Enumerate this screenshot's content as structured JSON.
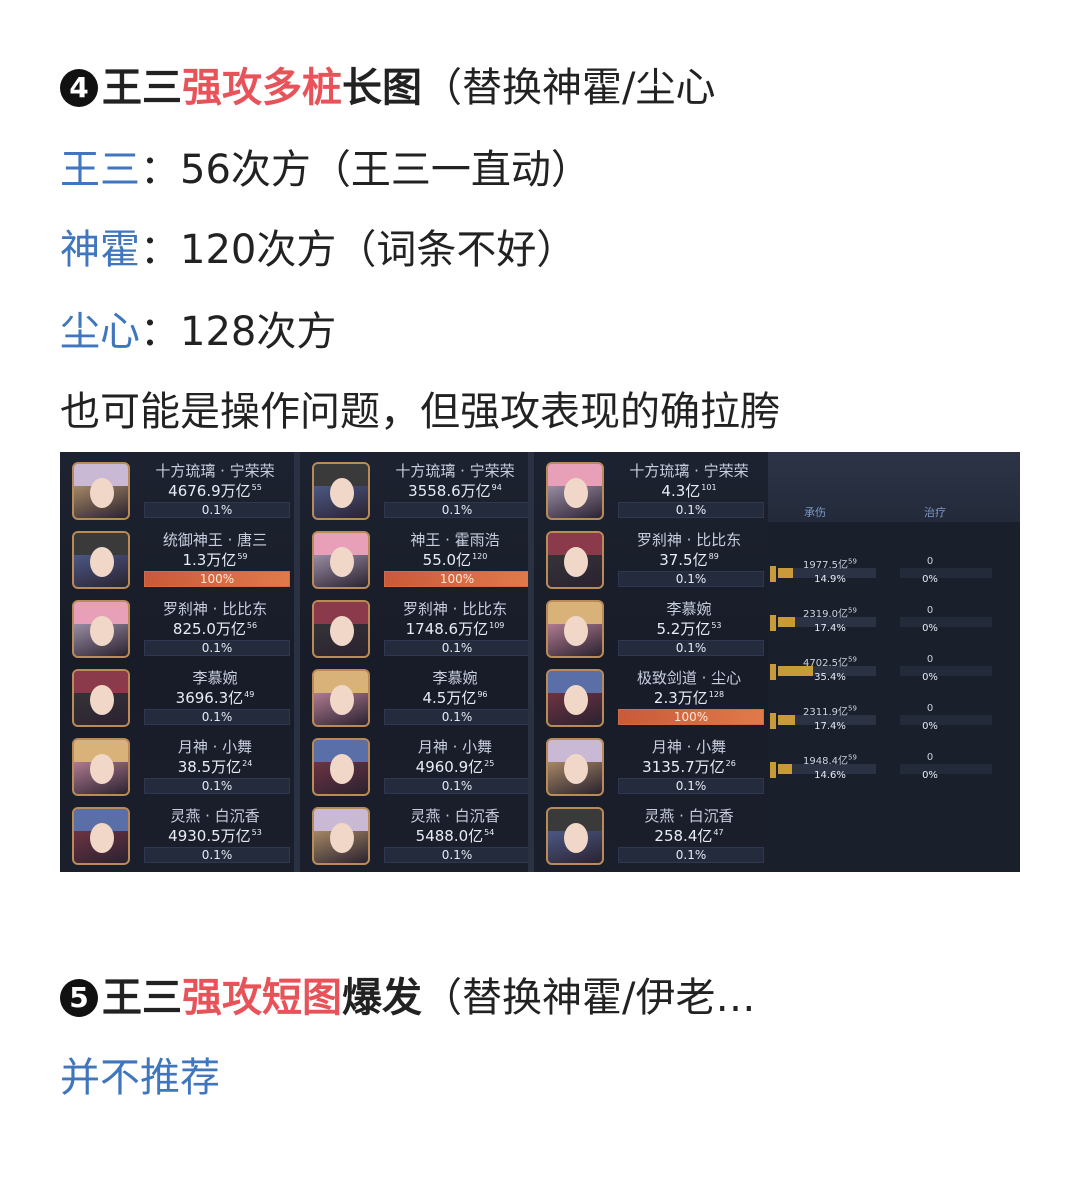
{
  "heading4": {
    "num": "4",
    "part1": "王三",
    "part2_red": "强攻多桩",
    "part3": "长图",
    "part4": "（替换神霍/尘心"
  },
  "lines": [
    {
      "label": "王三",
      "sep": "：",
      "text": "56次方（王三一直动）"
    },
    {
      "label": "神霍",
      "sep": "：",
      "text": "120次方（词条不好）"
    },
    {
      "label": "尘心",
      "sep": "：",
      "text": "128次方"
    }
  ],
  "note": "也可能是操作问题，但强攻表现的确拉胯",
  "screenshot": {
    "columns": [
      {
        "cards": [
          {
            "name": "十方琉璃 · 宁荣荣",
            "value": "4676.9万亿",
            "exp": "55",
            "pct": "0.1%",
            "full": false
          },
          {
            "name": "统御神王 · 唐三",
            "value": "1.3万亿",
            "exp": "59",
            "pct": "100%",
            "full": true
          },
          {
            "name": "罗刹神 · 比比东",
            "value": "825.0万亿",
            "exp": "56",
            "pct": "0.1%",
            "full": false
          },
          {
            "name": "李慕婉",
            "value": "3696.3亿",
            "exp": "49",
            "pct": "0.1%",
            "full": false
          },
          {
            "name": "月神 · 小舞",
            "value": "38.5万亿",
            "exp": "24",
            "pct": "0.1%",
            "full": false
          },
          {
            "name": "灵燕 · 白沉香",
            "value": "4930.5万亿",
            "exp": "53",
            "pct": "0.1%",
            "full": false
          }
        ]
      },
      {
        "cards": [
          {
            "name": "十方琉璃 · 宁荣荣",
            "value": "3558.6万亿",
            "exp": "94",
            "pct": "0.1%",
            "full": false
          },
          {
            "name": "神王 · 霍雨浩",
            "value": "55.0亿",
            "exp": "120",
            "pct": "100%",
            "full": true
          },
          {
            "name": "罗刹神 · 比比东",
            "value": "1748.6万亿",
            "exp": "109",
            "pct": "0.1%",
            "full": false
          },
          {
            "name": "李慕婉",
            "value": "4.5万亿",
            "exp": "96",
            "pct": "0.1%",
            "full": false
          },
          {
            "name": "月神 · 小舞",
            "value": "4960.9亿",
            "exp": "25",
            "pct": "0.1%",
            "full": false
          },
          {
            "name": "灵燕 · 白沉香",
            "value": "5488.0亿",
            "exp": "54",
            "pct": "0.1%",
            "full": false
          }
        ]
      },
      {
        "cards": [
          {
            "name": "十方琉璃 · 宁荣荣",
            "value": "4.3亿",
            "exp": "101",
            "pct": "0.1%",
            "full": false
          },
          {
            "name": "罗刹神 · 比比东",
            "value": "37.5亿",
            "exp": "89",
            "pct": "0.1%",
            "full": false
          },
          {
            "name": "李慕婉",
            "value": "5.2万亿",
            "exp": "53",
            "pct": "0.1%",
            "full": false
          },
          {
            "name": "极致剑道 · 尘心",
            "value": "2.3万亿",
            "exp": "128",
            "pct": "100%",
            "full": true
          },
          {
            "name": "月神 · 小舞",
            "value": "3135.7万亿",
            "exp": "26",
            "pct": "0.1%",
            "full": false
          },
          {
            "name": "灵燕 · 白沉香",
            "value": "258.4亿",
            "exp": "47",
            "pct": "0.1%",
            "full": false
          }
        ]
      }
    ],
    "panel": {
      "tab1": "承伤",
      "tab2": "治疗",
      "rows": [
        {
          "value": "1977.5亿",
          "exp": "59",
          "pct": "14.9%",
          "fill": 0.149,
          "v2": "0",
          "p2": "0%"
        },
        {
          "value": "2319.0亿",
          "exp": "59",
          "pct": "17.4%",
          "fill": 0.174,
          "v2": "0",
          "p2": "0%"
        },
        {
          "value": "4702.5亿",
          "exp": "59",
          "pct": "35.4%",
          "fill": 0.354,
          "v2": "0",
          "p2": "0%"
        },
        {
          "value": "2311.9亿",
          "exp": "59",
          "pct": "17.4%",
          "fill": 0.174,
          "v2": "0",
          "p2": "0%"
        },
        {
          "value": "1948.4亿",
          "exp": "59",
          "pct": "14.6%",
          "fill": 0.146,
          "v2": "0",
          "p2": "0%"
        }
      ]
    },
    "avatar_colors": [
      "#d9b27a",
      "#5a6fa8",
      "#c9b9d4",
      "#3a3a3a",
      "#e8a0b8",
      "#8a3a4a"
    ]
  },
  "heading5": {
    "num": "5",
    "part1": "王三",
    "part2_red": "强攻短图",
    "part3": "爆发",
    "part4": "（替换神霍/伊老…"
  },
  "recommend": "并不推荐"
}
